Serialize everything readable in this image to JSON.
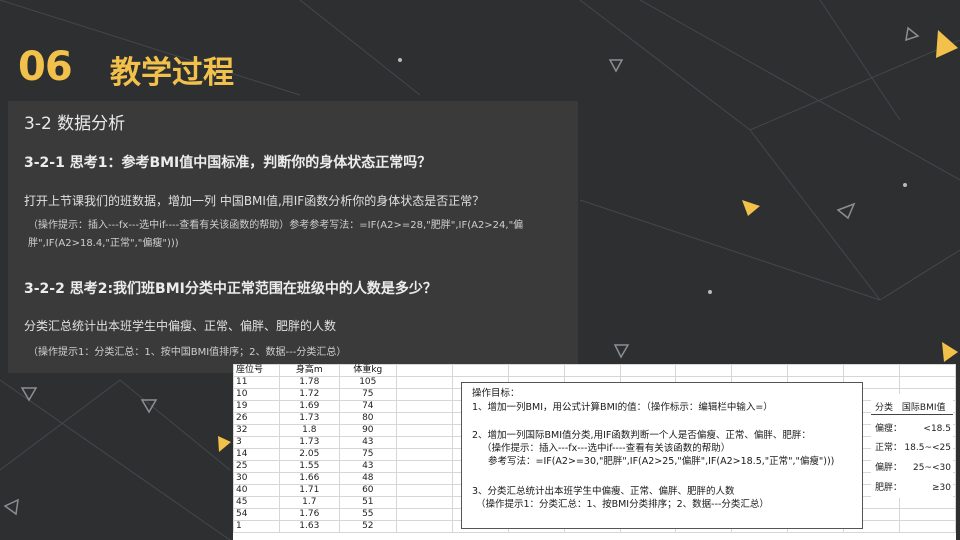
{
  "title": {
    "number": "06",
    "text": "教学过程"
  },
  "panel": {
    "heading": "3-2 数据分析",
    "q1": "3-2-1 思考1：参考BMI值中国标准，判断你的身体状态正常吗？",
    "task1": "打开上节课我们的班数据，增加一列 中国BMI值,用IF函数分析你的身体状态是否正常？",
    "hint1": "（操作提示：插入---fx---选中if----查看有关该函数的帮助）参考参考写法：=IF(A2>=28,\"肥胖\",IF(A2>24,\"偏胖\",IF(A2>18.4,\"正常\",\"偏瘦\")))",
    "q2": "3-2-2 思考2:我们班BMI分类中正常范围在班级中的人数是多少？",
    "task2": "分类汇总统计出本班学生中偏瘦、正常、偏胖、肥胖的人数",
    "hint2": "（操作提示1：分类汇总：1、按中国BMI值排序；2、数据---分类汇总）"
  },
  "sheet": {
    "headers": [
      "座位号",
      "身高m",
      "体重kg"
    ],
    "rows": [
      [
        "11",
        "1.78",
        "105"
      ],
      [
        "10",
        "1.72",
        "75"
      ],
      [
        "19",
        "1.69",
        "74"
      ],
      [
        "26",
        "1.73",
        "80"
      ],
      [
        "32",
        "1.8",
        "90"
      ],
      [
        "3",
        "1.73",
        "43"
      ],
      [
        "14",
        "2.05",
        "75"
      ],
      [
        "25",
        "1.55",
        "43"
      ],
      [
        "30",
        "1.66",
        "48"
      ],
      [
        "40",
        "1.71",
        "60"
      ],
      [
        "45",
        "1.7",
        "51"
      ],
      [
        "54",
        "1.76",
        "55"
      ],
      [
        "1",
        "1.63",
        "52"
      ]
    ],
    "goal": {
      "title": "操作目标：",
      "l1": "1、增加一列BMI，用公式计算BMI的值：（操作标示：编辑栏中输入=）",
      "l2": "2、增加一列国际BMI值分类,用IF函数判断一个人是否偏瘦、正常、偏胖、肥胖：",
      "l3": "（操作提示：插入---fx---选中if----查看有关该函数的帮助）",
      "l4": "参考写法：=IF(A2>=30,\"肥胖\",IF(A2>25,\"偏胖\",IF(A2>18.5,\"正常\",\"偏瘦\")))",
      "l5": "3、分类汇总统计出本班学生中偏瘦、正常、偏胖、肥胖的人数",
      "l6": "（操作提示1：分类汇总：1、按BMI分类排序；2、数据---分类汇总）"
    },
    "bmi": {
      "col1": "分类",
      "col2": "国际BMI值",
      "rows": [
        {
          "k": "偏瘦：",
          "v": "<18.5"
        },
        {
          "k": "正常：",
          "v": "18.5~<25"
        },
        {
          "k": "偏胖：",
          "v": "25~<30"
        },
        {
          "k": "肥胖：",
          "v": "≥30"
        }
      ]
    }
  },
  "colors": {
    "accent": "#f2c14b",
    "background": "#2d2f31",
    "panel": "#3a3a3b"
  }
}
